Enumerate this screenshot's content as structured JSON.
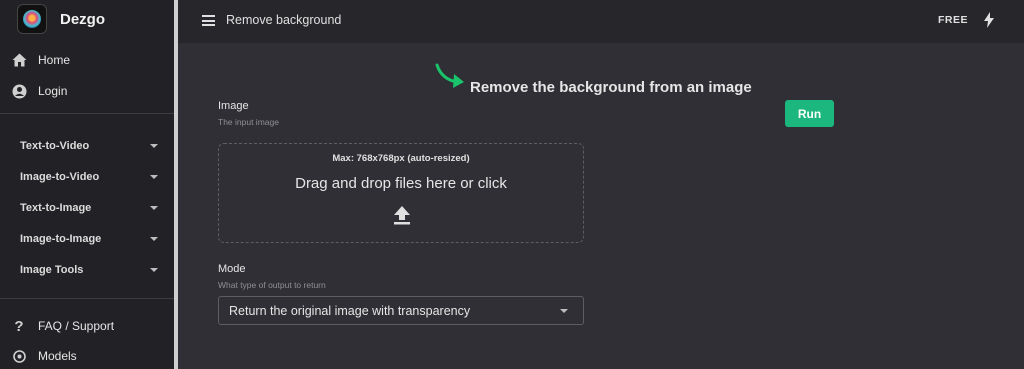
{
  "app": {
    "name": "Dezgo"
  },
  "sidebar": {
    "top_items": [
      {
        "label": "Home",
        "icon": "home-icon"
      },
      {
        "label": "Login",
        "icon": "account-circle-icon"
      }
    ],
    "groups": [
      {
        "label": "Text-to-Video"
      },
      {
        "label": "Image-to-Video"
      },
      {
        "label": "Text-to-Image"
      },
      {
        "label": "Image-to-Image"
      },
      {
        "label": "Image Tools"
      }
    ],
    "bottom_items": [
      {
        "label": "FAQ / Support",
        "icon": "question-icon"
      },
      {
        "label": "Models",
        "icon": "models-icon"
      }
    ]
  },
  "topbar": {
    "title": "Remove background",
    "plan": "FREE",
    "menu_icon": "hamburger-icon",
    "bolt_icon": "bolt-icon"
  },
  "main": {
    "headline": "Remove the background from an image",
    "run_label": "Run",
    "image_field": {
      "label": "Image",
      "hint": "The input image",
      "max_size": "Max: 768x768px (auto-resized)",
      "drop_text": "Drag and drop files here or click",
      "upload_icon": "upload-icon"
    },
    "mode_field": {
      "label": "Mode",
      "hint": "What type of output to return",
      "selected": "Return the original image with transparency"
    }
  },
  "colors": {
    "background": "#2f2f35",
    "sidebar": "#222226",
    "topbar": "#26262b",
    "accent": "#1cb67f",
    "arrow": "#19c46a"
  }
}
